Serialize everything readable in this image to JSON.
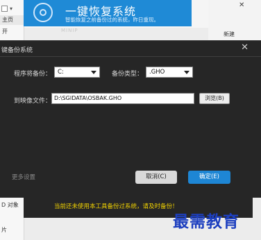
{
  "background": {
    "home_tab": "主页",
    "open_label": "开",
    "objects_label": "D 对象",
    "pictures_label": "片",
    "new_folder_label": "新建",
    "close_glyph": "✕"
  },
  "banner": {
    "title": "一键恢复系统",
    "subtitle": "智能恢复之前备份过的系统，昨日重现。",
    "faint_mark": "MINIP"
  },
  "dialog": {
    "title": "键备份系统",
    "close_glyph": "✕",
    "program_label": "程序将备份：",
    "drive_value": "C:",
    "backup_type_label": "备份类型：",
    "type_value": ".GHO",
    "image_file_label": "到映像文件：",
    "image_path": "D:\\SGIDATA\\OSBAK.GHO",
    "browse_label": "浏览(B)",
    "more_settings_label": "更多设置",
    "cancel_label": "取消(C)",
    "ok_label": "确定(E)"
  },
  "warning": {
    "text": "当前还未使用本工具备份过系统，请及时备份！"
  },
  "watermark": {
    "text": "最需教育"
  },
  "colors": {
    "banner_blue": "#1f8ad6",
    "dialog_bg": "#262626",
    "ok_blue": "#1e86d4",
    "warning_yellow": "#f2d300",
    "watermark_blue": "#1d3fbf"
  }
}
